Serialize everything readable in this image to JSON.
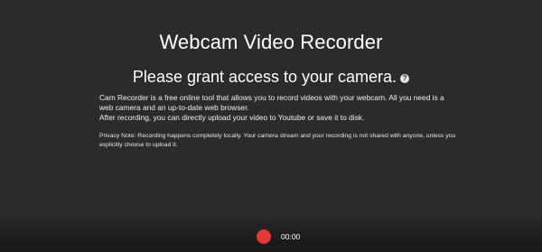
{
  "app": {
    "title": "Webcam Video Recorder"
  },
  "prompt": {
    "headline": "Please grant access to your camera.",
    "help_icon_glyph": "?"
  },
  "description": {
    "line1": "Cam Recorder is a free online tool that allows you to record videos with your webcam. All you need is a web camera and an up-to-date web browser.",
    "line2": "After recording, you can directly upload your video to Youtube or save it to disk."
  },
  "privacy": {
    "text": "Privacy Note: Recording happens completely locally. Your camera stream and your recording is not shared with anyone, unless you explicitly choose to upload it."
  },
  "controls": {
    "timer": "00:00",
    "record_color": "#e53935"
  },
  "theme": {
    "background": "#2b2b2b",
    "text": "#ffffff"
  }
}
